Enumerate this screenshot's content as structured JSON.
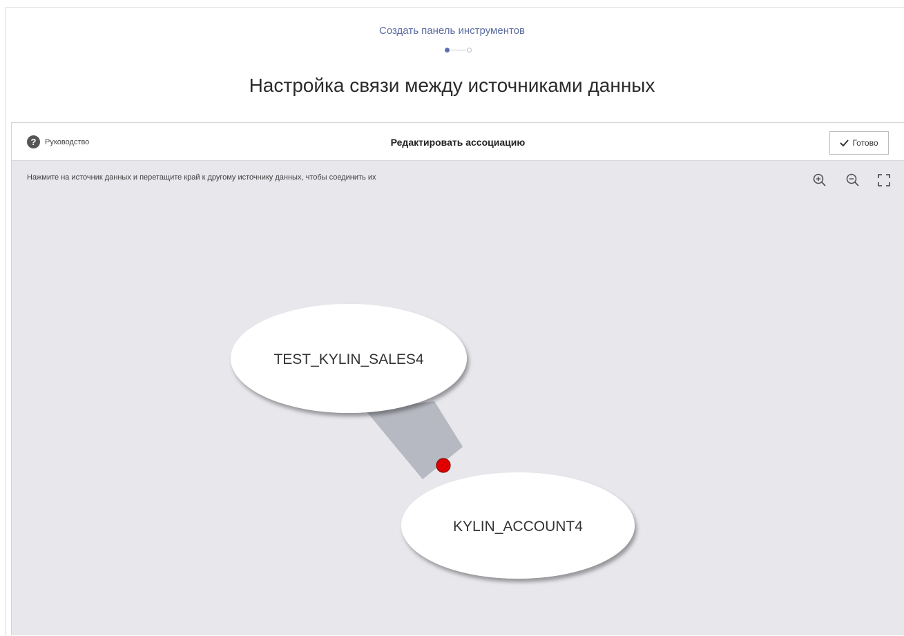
{
  "wizard": {
    "caption": "Создать панель инструментов",
    "step_current": 1,
    "step_total": 2
  },
  "page": {
    "title": "Настройка связи между источниками данных"
  },
  "toolbar": {
    "guide_label": "Руководство",
    "title": "Редактировать ассоциацию",
    "done_label": "Готово"
  },
  "canvas": {
    "hint": "Нажмите на источник данных и перетащите край к другому источнику данных, чтобы соединить их",
    "tools": [
      "zoom-in-icon",
      "zoom-out-icon",
      "fullscreen-icon"
    ],
    "nodes": [
      {
        "id": "n1",
        "label": "TEST_KYLIN_SALES4"
      },
      {
        "id": "n2",
        "label": "KYLIN_ACCOUNT4"
      }
    ],
    "edge_handle_color": "#e00000",
    "background_color": "#e7e7ec"
  }
}
